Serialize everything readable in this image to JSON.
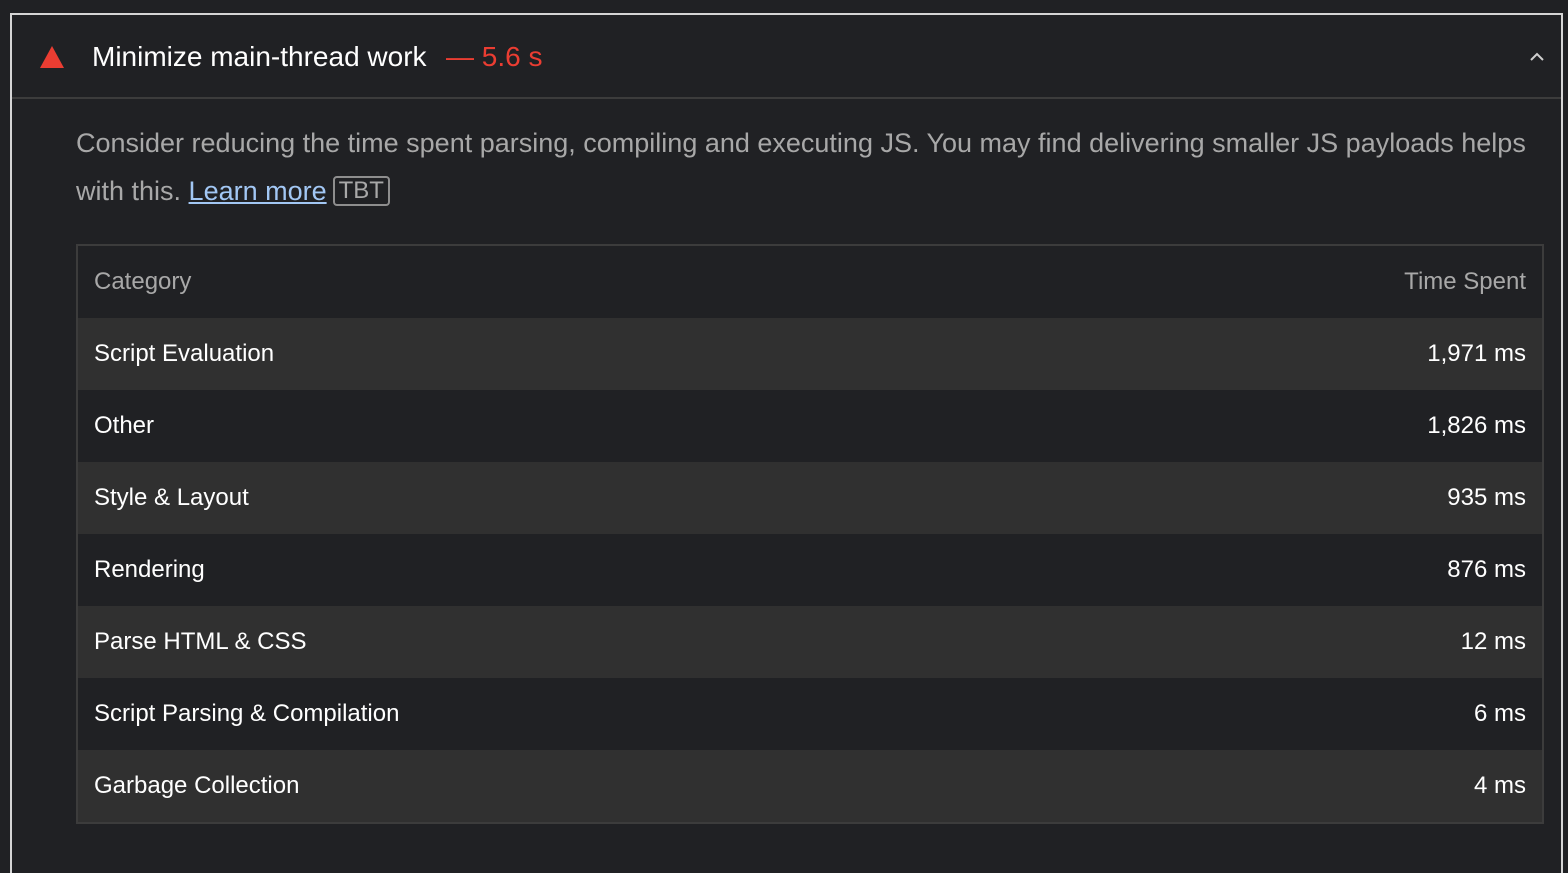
{
  "audit": {
    "title": "Minimize main-thread work",
    "score_text": "— 5.6 s",
    "status_color": "#eb3d32",
    "icon": "warning-triangle-icon",
    "toggle_icon": "chevron-up-icon"
  },
  "description": {
    "text": "Consider reducing the time spent parsing, compiling and executing JS. You may find delivering smaller JS payloads helps with this. ",
    "link_text": "Learn more",
    "badge": "TBT"
  },
  "table": {
    "headers": [
      "Category",
      "Time Spent"
    ],
    "rows": [
      {
        "category": "Script Evaluation",
        "time": "1,971 ms"
      },
      {
        "category": "Other",
        "time": "1,826 ms"
      },
      {
        "category": "Style & Layout",
        "time": "935 ms"
      },
      {
        "category": "Rendering",
        "time": "876 ms"
      },
      {
        "category": "Parse HTML & CSS",
        "time": "12 ms"
      },
      {
        "category": "Script Parsing & Compilation",
        "time": "6 ms"
      },
      {
        "category": "Garbage Collection",
        "time": "4 ms"
      }
    ]
  }
}
